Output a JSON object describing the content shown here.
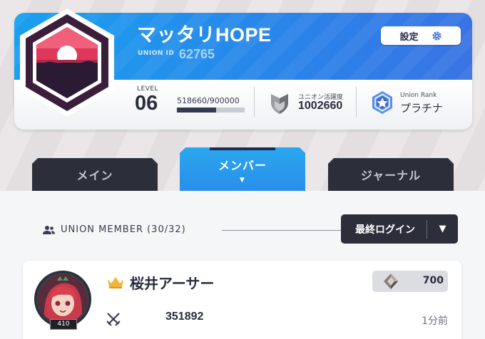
{
  "union": {
    "name": "マッタリHOPE",
    "id_label": "UNION ID",
    "id": "62765",
    "settings_label": "設定",
    "level_label": "LEVEL",
    "level": "06",
    "exp_text": "518660/900000",
    "exp_progress": 0.576,
    "activity_label": "ユニオン活躍度",
    "activity_value": "1002660",
    "rank_label": "Union Rank",
    "rank_value": "プラチナ"
  },
  "tabs": [
    {
      "label": "メイン"
    },
    {
      "label": "メンバー",
      "active": true,
      "indicator": "▼"
    },
    {
      "label": "ジャーナル"
    }
  ],
  "members_section": {
    "title": "UNION MEMBER (30/32)",
    "sort_label": "最終ログイン",
    "sort_arrow": "▼"
  },
  "members": [
    {
      "name": "桜井アーサー",
      "level": "410",
      "contribution": "700",
      "power": "351892",
      "last_login": "1分前",
      "icons": [
        "crown-icon",
        "crystal-icon",
        "crossed-swords-icon"
      ]
    }
  ],
  "colors": {
    "banner": "#1aa0ef",
    "tab_active": "#2aa7ef",
    "tab_inactive": "#2c2f3a",
    "emblem_frame": "#3b1f3a",
    "emblem_sunset": "#e0385a"
  }
}
